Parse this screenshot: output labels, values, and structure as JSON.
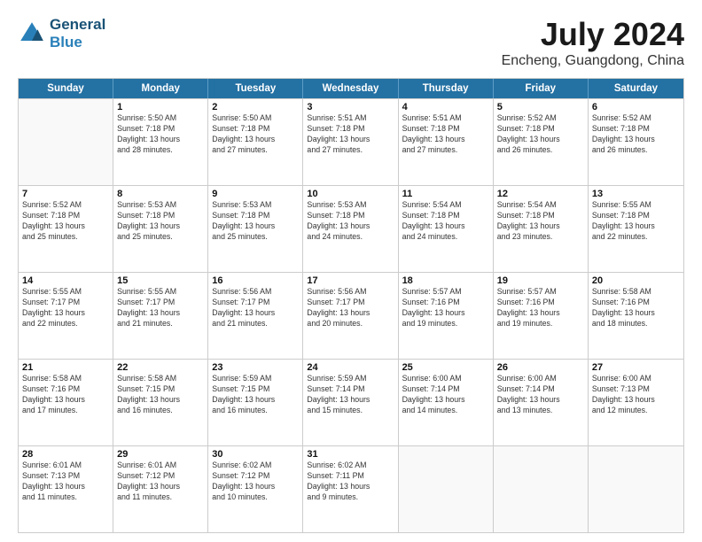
{
  "header": {
    "logo_line1": "General",
    "logo_line2": "Blue",
    "title": "July 2024",
    "subtitle": "Encheng, Guangdong, China"
  },
  "days_of_week": [
    "Sunday",
    "Monday",
    "Tuesday",
    "Wednesday",
    "Thursday",
    "Friday",
    "Saturday"
  ],
  "weeks": [
    [
      {
        "day": "",
        "info": ""
      },
      {
        "day": "1",
        "info": "Sunrise: 5:50 AM\nSunset: 7:18 PM\nDaylight: 13 hours\nand 28 minutes."
      },
      {
        "day": "2",
        "info": "Sunrise: 5:50 AM\nSunset: 7:18 PM\nDaylight: 13 hours\nand 27 minutes."
      },
      {
        "day": "3",
        "info": "Sunrise: 5:51 AM\nSunset: 7:18 PM\nDaylight: 13 hours\nand 27 minutes."
      },
      {
        "day": "4",
        "info": "Sunrise: 5:51 AM\nSunset: 7:18 PM\nDaylight: 13 hours\nand 27 minutes."
      },
      {
        "day": "5",
        "info": "Sunrise: 5:52 AM\nSunset: 7:18 PM\nDaylight: 13 hours\nand 26 minutes."
      },
      {
        "day": "6",
        "info": "Sunrise: 5:52 AM\nSunset: 7:18 PM\nDaylight: 13 hours\nand 26 minutes."
      }
    ],
    [
      {
        "day": "7",
        "info": "Sunrise: 5:52 AM\nSunset: 7:18 PM\nDaylight: 13 hours\nand 25 minutes."
      },
      {
        "day": "8",
        "info": "Sunrise: 5:53 AM\nSunset: 7:18 PM\nDaylight: 13 hours\nand 25 minutes."
      },
      {
        "day": "9",
        "info": "Sunrise: 5:53 AM\nSunset: 7:18 PM\nDaylight: 13 hours\nand 25 minutes."
      },
      {
        "day": "10",
        "info": "Sunrise: 5:53 AM\nSunset: 7:18 PM\nDaylight: 13 hours\nand 24 minutes."
      },
      {
        "day": "11",
        "info": "Sunrise: 5:54 AM\nSunset: 7:18 PM\nDaylight: 13 hours\nand 24 minutes."
      },
      {
        "day": "12",
        "info": "Sunrise: 5:54 AM\nSunset: 7:18 PM\nDaylight: 13 hours\nand 23 minutes."
      },
      {
        "day": "13",
        "info": "Sunrise: 5:55 AM\nSunset: 7:18 PM\nDaylight: 13 hours\nand 22 minutes."
      }
    ],
    [
      {
        "day": "14",
        "info": "Sunrise: 5:55 AM\nSunset: 7:17 PM\nDaylight: 13 hours\nand 22 minutes."
      },
      {
        "day": "15",
        "info": "Sunrise: 5:55 AM\nSunset: 7:17 PM\nDaylight: 13 hours\nand 21 minutes."
      },
      {
        "day": "16",
        "info": "Sunrise: 5:56 AM\nSunset: 7:17 PM\nDaylight: 13 hours\nand 21 minutes."
      },
      {
        "day": "17",
        "info": "Sunrise: 5:56 AM\nSunset: 7:17 PM\nDaylight: 13 hours\nand 20 minutes."
      },
      {
        "day": "18",
        "info": "Sunrise: 5:57 AM\nSunset: 7:16 PM\nDaylight: 13 hours\nand 19 minutes."
      },
      {
        "day": "19",
        "info": "Sunrise: 5:57 AM\nSunset: 7:16 PM\nDaylight: 13 hours\nand 19 minutes."
      },
      {
        "day": "20",
        "info": "Sunrise: 5:58 AM\nSunset: 7:16 PM\nDaylight: 13 hours\nand 18 minutes."
      }
    ],
    [
      {
        "day": "21",
        "info": "Sunrise: 5:58 AM\nSunset: 7:16 PM\nDaylight: 13 hours\nand 17 minutes."
      },
      {
        "day": "22",
        "info": "Sunrise: 5:58 AM\nSunset: 7:15 PM\nDaylight: 13 hours\nand 16 minutes."
      },
      {
        "day": "23",
        "info": "Sunrise: 5:59 AM\nSunset: 7:15 PM\nDaylight: 13 hours\nand 16 minutes."
      },
      {
        "day": "24",
        "info": "Sunrise: 5:59 AM\nSunset: 7:14 PM\nDaylight: 13 hours\nand 15 minutes."
      },
      {
        "day": "25",
        "info": "Sunrise: 6:00 AM\nSunset: 7:14 PM\nDaylight: 13 hours\nand 14 minutes."
      },
      {
        "day": "26",
        "info": "Sunrise: 6:00 AM\nSunset: 7:14 PM\nDaylight: 13 hours\nand 13 minutes."
      },
      {
        "day": "27",
        "info": "Sunrise: 6:00 AM\nSunset: 7:13 PM\nDaylight: 13 hours\nand 12 minutes."
      }
    ],
    [
      {
        "day": "28",
        "info": "Sunrise: 6:01 AM\nSunset: 7:13 PM\nDaylight: 13 hours\nand 11 minutes."
      },
      {
        "day": "29",
        "info": "Sunrise: 6:01 AM\nSunset: 7:12 PM\nDaylight: 13 hours\nand 11 minutes."
      },
      {
        "day": "30",
        "info": "Sunrise: 6:02 AM\nSunset: 7:12 PM\nDaylight: 13 hours\nand 10 minutes."
      },
      {
        "day": "31",
        "info": "Sunrise: 6:02 AM\nSunset: 7:11 PM\nDaylight: 13 hours\nand 9 minutes."
      },
      {
        "day": "",
        "info": ""
      },
      {
        "day": "",
        "info": ""
      },
      {
        "day": "",
        "info": ""
      }
    ]
  ]
}
